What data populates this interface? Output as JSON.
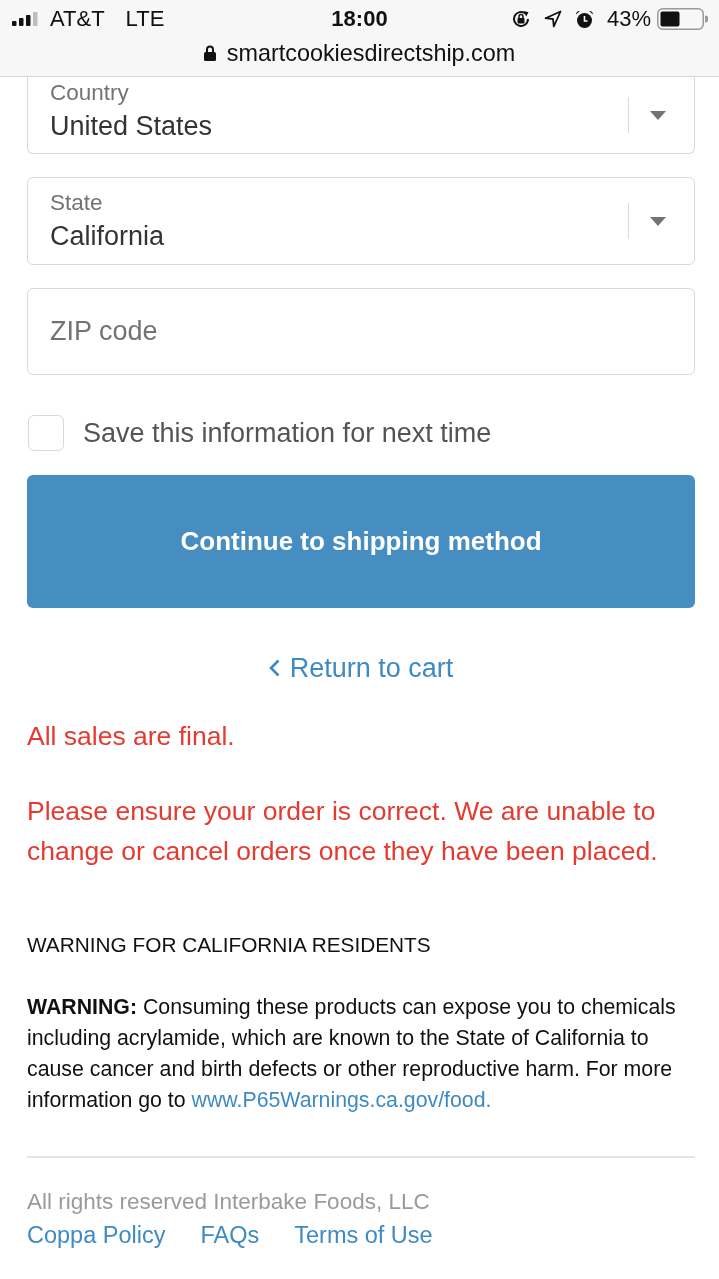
{
  "status_bar": {
    "carrier": "AT&T",
    "network": "LTE",
    "time": "18:00",
    "battery": "43%"
  },
  "address_bar": {
    "url": "smartcookiesdirectship.com",
    "secure": true
  },
  "form": {
    "fields": [
      {
        "kind": "select",
        "label": "Country",
        "value": "United States"
      },
      {
        "kind": "select",
        "label": "State",
        "value": "California"
      },
      {
        "kind": "text",
        "placeholder": "ZIP code"
      }
    ],
    "save_info": {
      "label": "Save this information for next time",
      "checked": false
    },
    "submit": "Continue to shipping method",
    "back_link": "Return to cart"
  },
  "notices": [
    "All sales are final.",
    "Please ensure your order is correct. We are unable to change or cancel orders once they have been placed."
  ],
  "warning": {
    "heading": "WARNING FOR CALIFORNIA RESIDENTS",
    "text": "**WARNING:** Consuming these products can expose you to chemicals including acrylamide, which are known to the State of California to cause cancer and birth defects or other reproductive harm. For more information go to",
    "link": "www.P65Warnings.ca.gov/food."
  },
  "footer": {
    "copyright": "All rights reserved Interbake Foods, LLC",
    "links": [
      "Coppa Policy",
      "FAQs",
      "Terms of Use"
    ]
  }
}
